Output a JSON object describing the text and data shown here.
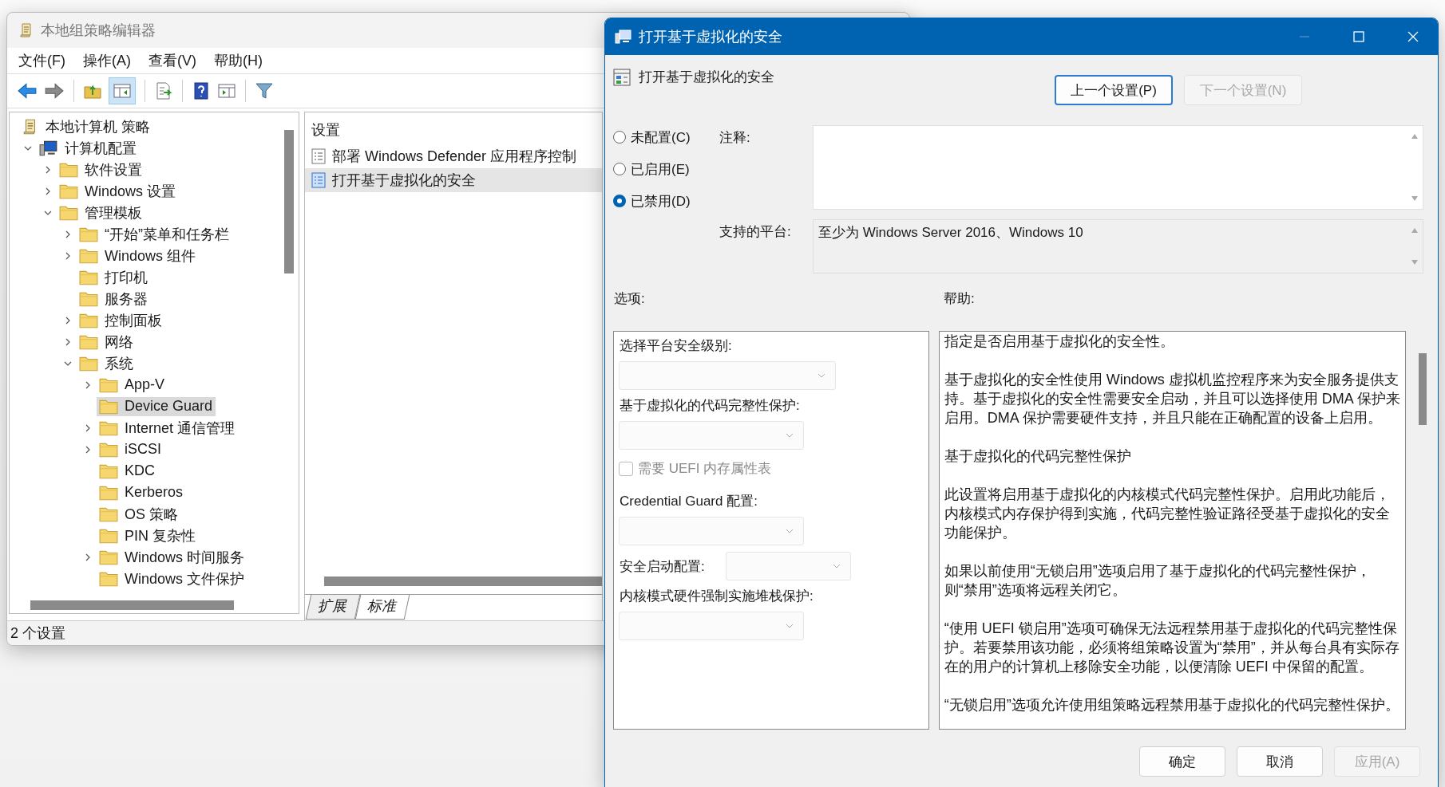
{
  "main_window": {
    "title": "本地组策略编辑器",
    "menu": [
      "文件(F)",
      "操作(A)",
      "查看(V)",
      "帮助(H)"
    ],
    "tree": [
      {
        "label": "本地计算机 策略",
        "selected": false,
        "children": [
          {
            "label": "计算机配置",
            "expanded": true,
            "selected": false,
            "children": [
              {
                "label": "软件设置",
                "expanded": false,
                "selected": false
              },
              {
                "label": "Windows 设置",
                "expanded": false,
                "selected": false
              },
              {
                "label": "管理模板",
                "expanded": true,
                "selected": false,
                "children": [
                  {
                    "label": "“开始”菜单和任务栏",
                    "expanded": false,
                    "selected": false
                  },
                  {
                    "label": "Windows 组件",
                    "expanded": false,
                    "selected": false
                  },
                  {
                    "label": "打印机",
                    "selected": false
                  },
                  {
                    "label": "服务器",
                    "selected": false
                  },
                  {
                    "label": "控制面板",
                    "expanded": false,
                    "selected": false
                  },
                  {
                    "label": "网络",
                    "expanded": false,
                    "selected": false
                  },
                  {
                    "label": "系统",
                    "expanded": true,
                    "selected": false,
                    "children": [
                      {
                        "label": "App-V",
                        "expanded": false,
                        "selected": false
                      },
                      {
                        "label": "Device Guard",
                        "selected": true
                      },
                      {
                        "label": "Internet 通信管理",
                        "expanded": false,
                        "selected": false
                      },
                      {
                        "label": "iSCSI",
                        "expanded": false,
                        "selected": false
                      },
                      {
                        "label": "KDC",
                        "selected": false
                      },
                      {
                        "label": "Kerberos",
                        "selected": false
                      },
                      {
                        "label": "OS 策略",
                        "selected": false
                      },
                      {
                        "label": "PIN 复杂性",
                        "selected": false
                      },
                      {
                        "label": "Windows 时间服务",
                        "expanded": false,
                        "selected": false
                      },
                      {
                        "label": "Windows 文件保护",
                        "selected": false
                      }
                    ]
                  }
                ]
              }
            ]
          }
        ]
      }
    ],
    "list_header": "设置",
    "settings": [
      {
        "label": "部署 Windows Defender 应用程序控制",
        "selected": false
      },
      {
        "label": "打开基于虚拟化的安全",
        "selected": true
      }
    ],
    "tabs": [
      {
        "label": "扩展",
        "selected": false
      },
      {
        "label": "标准",
        "selected": true
      }
    ],
    "status": "2 个设置"
  },
  "dialog": {
    "title": "打开基于虚拟化的安全",
    "setting_name": "打开基于虚拟化的安全",
    "nav_buttons": [
      {
        "label": "上一个设置(P)",
        "disabled": false
      },
      {
        "label": "下一个设置(N)",
        "disabled": true
      }
    ],
    "states": [
      {
        "label": "未配置(C)",
        "selected": false
      },
      {
        "label": "已启用(E)",
        "selected": false
      },
      {
        "label": "已禁用(D)",
        "selected": true
      }
    ],
    "comment_label": "注释:",
    "platform_label": "支持的平台:",
    "platform_value": "至少为 Windows Server 2016、Windows 10",
    "options_label": "选项:",
    "help_label": "帮助:",
    "options": [
      {
        "kind": "dropdown",
        "label": "选择平台安全级别:",
        "wide": true
      },
      {
        "kind": "dropdown",
        "label": "基于虚拟化的代码完整性保护:",
        "wide": false
      },
      {
        "kind": "checkbox",
        "label": "需要 UEFI 内存属性表",
        "checked": false
      },
      {
        "kind": "dropdown",
        "label": "Credential Guard 配置:",
        "wide": false
      },
      {
        "kind": "inline",
        "label": "安全启动配置:"
      },
      {
        "kind": "dropdown",
        "label": "内核模式硬件强制实施堆栈保护:",
        "wide": false
      }
    ],
    "help": [
      "指定是否启用基于虚拟化的安全性。",
      "基于虚拟化的安全性使用 Windows 虚拟机监控程序来为安全服务提供支持。基于虚拟化的安全性需要安全启动，并且可以选择使用 DMA 保护来启用。DMA 保护需要硬件支持，并且只能在正确配置的设备上启用。",
      "基于虚拟化的代码完整性保护",
      "此设置将启用基于虚拟化的内核模式代码完整性保护。启用此功能后，内核模式内存保护得到实施，代码完整性验证路径受基于虚拟化的安全功能保护。",
      "如果以前使用“无锁启用”选项启用了基于虚拟化的代码完整性保护，则“禁用”选项将远程关闭它。",
      "“使用 UEFI 锁启用”选项可确保无法远程禁用基于虚拟化的代码完整性保护。若要禁用该功能，必须将组策略设置为“禁用”，并从每台具有实际存在的用户的计算机上移除安全功能，以便清除 UEFI 中保留的配置。",
      "“无锁启用”选项允许使用组策略远程禁用基于虚拟化的代码完整性保护。"
    ],
    "buttons": [
      {
        "label": "确定",
        "disabled": false
      },
      {
        "label": "取消",
        "disabled": false
      },
      {
        "label": "应用(A)",
        "disabled": true
      }
    ]
  }
}
